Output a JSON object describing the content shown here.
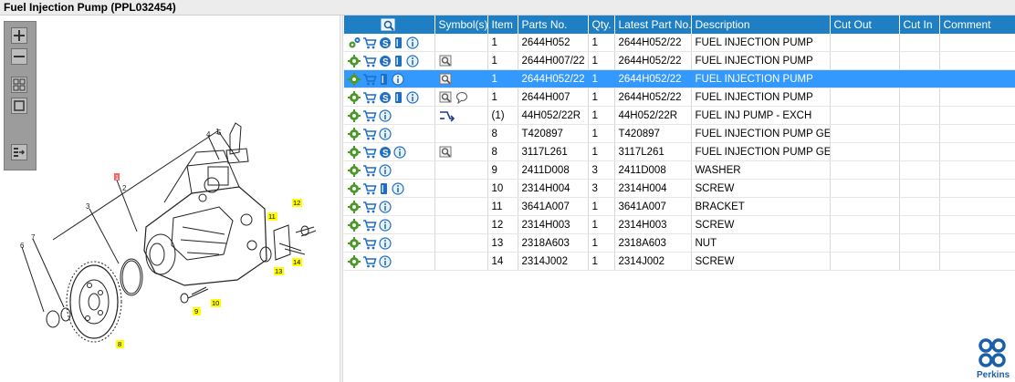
{
  "window": {
    "title": "Fuel Injection Pump (PPL032454)"
  },
  "columns": [
    "",
    "Symbol(s)",
    "Item",
    "Parts No.",
    "Qty.",
    "Latest Part No.",
    "Description",
    "Cut Out",
    "Cut In",
    "Comment"
  ],
  "rows": [
    {
      "icons": [
        "settings",
        "cart",
        "s",
        "doc",
        "info"
      ],
      "symbols": [],
      "item": "1",
      "part": "2644H052",
      "qty": "1",
      "latest": "2644H052/22",
      "desc": "FUEL INJECTION PUMP",
      "selected": false
    },
    {
      "icons": [
        "gear",
        "cart",
        "s",
        "doc",
        "info"
      ],
      "symbols": [
        "magnifier"
      ],
      "item": "1",
      "part": "2644H007/22",
      "qty": "1",
      "latest": "2644H052/22",
      "desc": "FUEL INJECTION PUMP",
      "selected": false
    },
    {
      "icons": [
        "gear",
        "cart",
        "doc",
        "info"
      ],
      "symbols": [
        "magnifier"
      ],
      "item": "1",
      "part": "2644H052/22",
      "qty": "1",
      "latest": "2644H052/22",
      "desc": "FUEL INJECTION PUMP",
      "selected": true
    },
    {
      "icons": [
        "gear",
        "cart",
        "s",
        "doc",
        "info"
      ],
      "symbols": [
        "magnifier",
        "note"
      ],
      "item": "1",
      "part": "2644H007",
      "qty": "1",
      "latest": "2644H052/22",
      "desc": "FUEL INJECTION PUMP",
      "selected": false
    },
    {
      "icons": [
        "gear",
        "cart",
        "info"
      ],
      "symbols": [
        "exchange"
      ],
      "item": "(1)",
      "part": "44H052/22R",
      "qty": "1",
      "latest": "44H052/22R",
      "desc": "FUEL INJ PUMP - EXCH",
      "selected": false
    },
    {
      "icons": [
        "gear",
        "cart",
        "info"
      ],
      "symbols": [],
      "item": "8",
      "part": "T420897",
      "qty": "1",
      "latest": "T420897",
      "desc": "FUEL INJECTION PUMP GEAR",
      "selected": false
    },
    {
      "icons": [
        "gear",
        "cart",
        "s",
        "info"
      ],
      "symbols": [
        "magnifier"
      ],
      "item": "8",
      "part": "3117L261",
      "qty": "1",
      "latest": "3117L261",
      "desc": "FUEL INJECTION PUMP GEAR",
      "selected": false
    },
    {
      "icons": [
        "gear",
        "cart",
        "info"
      ],
      "symbols": [],
      "item": "9",
      "part": "2411D008",
      "qty": "3",
      "latest": "2411D008",
      "desc": "WASHER",
      "selected": false
    },
    {
      "icons": [
        "gear",
        "cart",
        "doc",
        "info"
      ],
      "symbols": [],
      "item": "10",
      "part": "2314H004",
      "qty": "3",
      "latest": "2314H004",
      "desc": "SCREW",
      "selected": false
    },
    {
      "icons": [
        "gear",
        "cart",
        "info"
      ],
      "symbols": [],
      "item": "11",
      "part": "3641A007",
      "qty": "1",
      "latest": "3641A007",
      "desc": "BRACKET",
      "selected": false
    },
    {
      "icons": [
        "gear",
        "cart",
        "info"
      ],
      "symbols": [],
      "item": "12",
      "part": "2314H003",
      "qty": "1",
      "latest": "2314H003",
      "desc": "SCREW",
      "selected": false
    },
    {
      "icons": [
        "gear",
        "cart",
        "info"
      ],
      "symbols": [],
      "item": "13",
      "part": "2318A603",
      "qty": "1",
      "latest": "2318A603",
      "desc": "NUT",
      "selected": false
    },
    {
      "icons": [
        "gear",
        "cart",
        "info"
      ],
      "symbols": [],
      "item": "14",
      "part": "2314J002",
      "qty": "1",
      "latest": "2314J002",
      "desc": "SCREW",
      "selected": false
    }
  ],
  "callouts": {
    "plain": [
      "1",
      "2",
      "3",
      "4",
      "5",
      "6",
      "7"
    ],
    "highlighted": [
      "8",
      "9",
      "10",
      "11",
      "12",
      "13",
      "14"
    ]
  },
  "brand": {
    "name": "Perkins",
    "color": "#1a5fa8"
  },
  "colors": {
    "header": "#1e7fc4",
    "selected": "#3399ff",
    "callout": "#ffff00"
  }
}
